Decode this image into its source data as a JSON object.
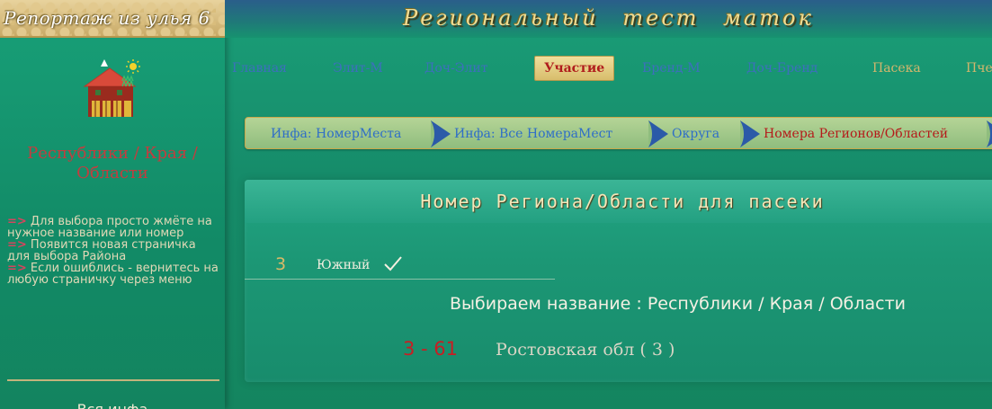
{
  "sidebar": {
    "banner": "Репортаж из улья 6",
    "title": "Республики / Края / Области",
    "hints": [
      {
        "arrow": "=>",
        "text": " Для выбора просто жмёте на нужное название или номер"
      },
      {
        "arrow": "=>",
        "text": " Появится новая страничка для выбора Района"
      },
      {
        "arrow": "=>",
        "text": " Если ошиблись - вернитесь на любую страничку через меню"
      }
    ],
    "footer": "Вся инфа"
  },
  "header": {
    "site_title": "Региональный тест маток"
  },
  "nav": {
    "items": [
      {
        "label": "Главная"
      },
      {
        "label": "Элит-М"
      },
      {
        "label": "Доч-Элит"
      },
      {
        "label": "Участие"
      },
      {
        "label": "Бренд-М"
      },
      {
        "label": "Доч-Бренд"
      },
      {
        "label": "Пасека"
      },
      {
        "label": "Пче"
      }
    ]
  },
  "breadcrumb": {
    "items": [
      {
        "label": "Инфа: НомерМеста"
      },
      {
        "label": "Инфа: Все НомераМест"
      },
      {
        "label": "Округа"
      },
      {
        "label": "Номера Регионов/Областей"
      }
    ]
  },
  "panel": {
    "title": "Номер Региона/Области для пасеки",
    "district": {
      "number": "3",
      "name": "Южный"
    },
    "choose_label": "Выбираем название : Республики / Края / Области",
    "region": {
      "code": "3 - 61",
      "name": "Ростовская обл ( 3 )"
    }
  },
  "colors": {
    "background": "#168b69",
    "accent_red": "#c81e23",
    "link_blue": "#3d6fbd",
    "gold": "#d4b66c"
  }
}
